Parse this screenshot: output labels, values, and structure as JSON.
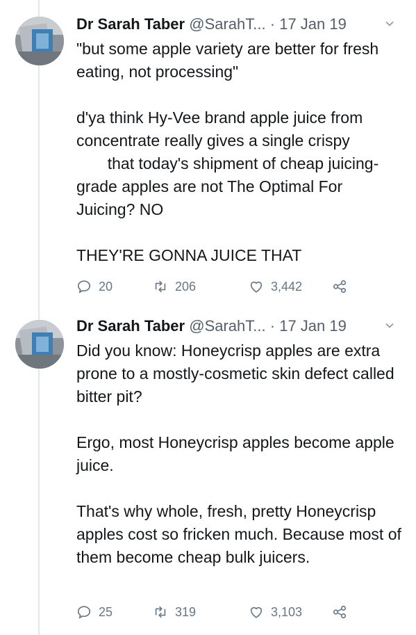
{
  "tweets": [
    {
      "author_name": "Dr Sarah Taber",
      "handle": "@SarahT...",
      "separator": "·",
      "date": "17 Jan 19",
      "paragraphs": [
        "\"but some apple variety are better for fresh eating, not processing\"",
        "d'ya think Hy-Vee brand apple juice from concentrate really gives a single crispy\n       that today's shipment of cheap juicing-grade apples are not The Optimal For Juicing? NO",
        "THEY'RE GONNA JUICE THAT"
      ],
      "replies": "20",
      "retweets": "206",
      "likes": "3,442"
    },
    {
      "author_name": "Dr Sarah Taber",
      "handle": "@SarahT...",
      "separator": "·",
      "date": "17 Jan 19",
      "paragraphs": [
        "Did you know: Honeycrisp apples are extra prone to a mostly-cosmetic skin defect called bitter pit?",
        "Ergo, most Honeycrisp apples become apple juice.",
        "That's why whole, fresh, pretty Honeycrisp apples cost so fricken much. Because most of them become cheap bulk juicers."
      ],
      "replies": "25",
      "retweets": "319",
      "likes": "3,103"
    }
  ],
  "icons": {
    "reply": "reply-icon",
    "retweet": "retweet-icon",
    "like": "heart-icon",
    "share": "share-icon",
    "menu": "chevron-down-icon"
  },
  "colors": {
    "text": "#14171a",
    "secondary": "#657786",
    "thread_line": "#e1e8ed"
  }
}
